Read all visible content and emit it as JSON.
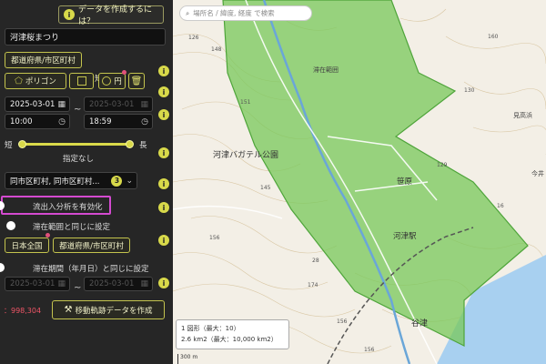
{
  "panel": {
    "help_label": "データを作成するには？",
    "name_value": "河津桜まつり",
    "area_button": "都道府県/市区町村",
    "shape_buttons": [
      "ポリゴン",
      "矩形",
      "円"
    ],
    "date_from": "2025-03-01",
    "date_to_placeholder": "2025-03-01",
    "time_from": "10:00",
    "time_to": "18:59",
    "tilde": "~",
    "slider_min_label": "短",
    "slider_max_label": "長",
    "slider_value": "指定なし",
    "region_select": "同市区町村, 同市区町村...",
    "region_count": "3",
    "flow_toggle_label": "流出入分析を有効化",
    "same_area_label": "滞在範囲と同じに設定",
    "scope_buttons": [
      "日本全国",
      "都道府県/市区町村"
    ],
    "same_period_label": "滞在期間（年月日）と同じに設定",
    "period_from": "2025-03-01",
    "period_to": "2025-03-01",
    "count": "：998,304",
    "create_button": "移動軌跡データを作成"
  },
  "map": {
    "search_placeholder": "場所名 / 緯度, 経度 で検索",
    "labels": {
      "park": "河津バガテル公園",
      "station": "河津駅",
      "sasahara": "笹原",
      "yato": "谷津",
      "stay_area": "滞在範囲",
      "mine": "見高浜",
      "imai": "今井"
    },
    "elevations": [
      "126",
      "148",
      "151",
      "160",
      "130",
      "145",
      "156",
      "28",
      "174",
      "173",
      "156",
      "16",
      "129",
      "156"
    ],
    "info_line1": "1 図形（最大：10）",
    "info_line2": "2.6 km2（最大：10,000 km2）",
    "scale": "300 m",
    "polygon_color": "#78c85a"
  }
}
